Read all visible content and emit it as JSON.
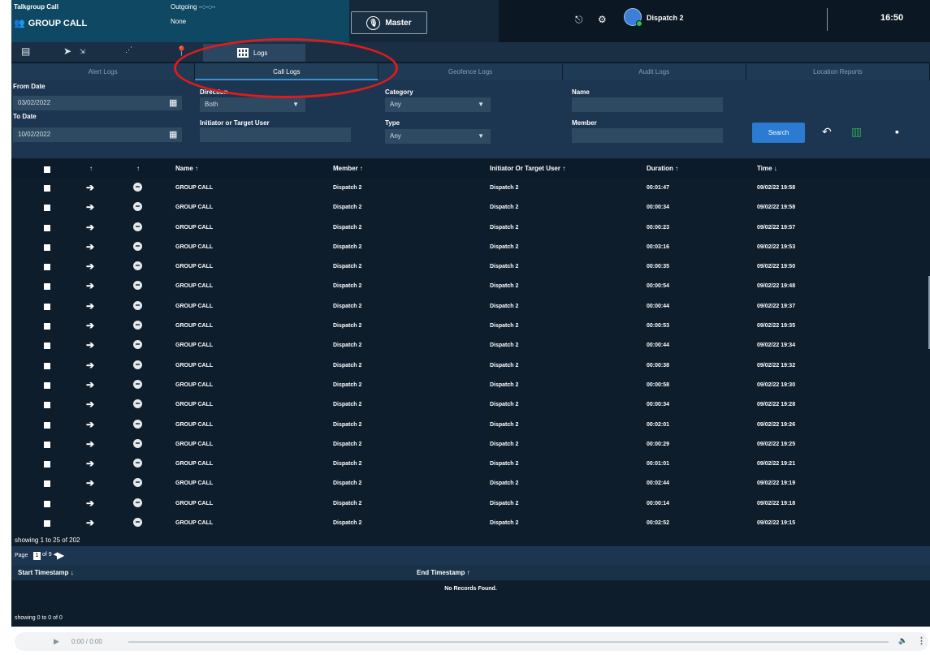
{
  "topbar": {
    "talkgroup_label": "Talkgroup Call",
    "group_name": "GROUP CALL",
    "outgoing_label": "Outgoing --:--:--",
    "outgoing_value": "None",
    "master_label": "Master",
    "user_name": "Dispatch 2",
    "clock": "16:50"
  },
  "nav": {
    "logs_label": "Logs"
  },
  "subtabs": [
    "Alert Logs",
    "Call Logs",
    "Geofence Logs",
    "Audit Logs",
    "Location Reports"
  ],
  "filters": {
    "from_date_label": "From Date",
    "from_date": "03/02/2022",
    "to_date_label": "To Date",
    "to_date": "10/02/2022",
    "direction_label": "Direction",
    "direction": "Both",
    "initiator_label": "Initiator or Target User",
    "initiator_value": "",
    "category_label": "Category",
    "category": "Any",
    "type_label": "Type",
    "type": "Any",
    "name_label": "Name",
    "name_value": "",
    "member_label": "Member",
    "member_value": "",
    "search_label": "Search"
  },
  "table": {
    "col_dir": "↑",
    "col_status": "↑",
    "headers": [
      "Name ↑",
      "Member ↑",
      "Initiator Or Target User ↑",
      "Duration ↑",
      "Time ↓"
    ],
    "rows": [
      {
        "name": "GROUP CALL",
        "member": "Dispatch 2",
        "initiator": "Dispatch 2",
        "duration": "00:01:47",
        "time": "09/02/22 19:58"
      },
      {
        "name": "GROUP CALL",
        "member": "Dispatch 2",
        "initiator": "Dispatch 2",
        "duration": "00:00:34",
        "time": "09/02/22 19:58"
      },
      {
        "name": "GROUP CALL",
        "member": "Dispatch 2",
        "initiator": "Dispatch 2",
        "duration": "00:00:23",
        "time": "09/02/22 19:57"
      },
      {
        "name": "GROUP CALL",
        "member": "Dispatch 2",
        "initiator": "Dispatch 2",
        "duration": "00:03:16",
        "time": "09/02/22 19:53"
      },
      {
        "name": "GROUP CALL",
        "member": "Dispatch 2",
        "initiator": "Dispatch 2",
        "duration": "00:00:35",
        "time": "09/02/22 19:50"
      },
      {
        "name": "GROUP CALL",
        "member": "Dispatch 2",
        "initiator": "Dispatch 2",
        "duration": "00:00:54",
        "time": "09/02/22 19:48"
      },
      {
        "name": "GROUP CALL",
        "member": "Dispatch 2",
        "initiator": "Dispatch 2",
        "duration": "00:00:44",
        "time": "09/02/22 19:37"
      },
      {
        "name": "GROUP CALL",
        "member": "Dispatch 2",
        "initiator": "Dispatch 2",
        "duration": "00:00:53",
        "time": "09/02/22 19:35"
      },
      {
        "name": "GROUP CALL",
        "member": "Dispatch 2",
        "initiator": "Dispatch 2",
        "duration": "00:00:44",
        "time": "09/02/22 19:34"
      },
      {
        "name": "GROUP CALL",
        "member": "Dispatch 2",
        "initiator": "Dispatch 2",
        "duration": "00:00:38",
        "time": "09/02/22 19:32"
      },
      {
        "name": "GROUP CALL",
        "member": "Dispatch 2",
        "initiator": "Dispatch 2",
        "duration": "00:00:58",
        "time": "09/02/22 19:30"
      },
      {
        "name": "GROUP CALL",
        "member": "Dispatch 2",
        "initiator": "Dispatch 2",
        "duration": "00:00:34",
        "time": "09/02/22 19:28"
      },
      {
        "name": "GROUP CALL",
        "member": "Dispatch 2",
        "initiator": "Dispatch 2",
        "duration": "00:02:01",
        "time": "09/02/22 19:26"
      },
      {
        "name": "GROUP CALL",
        "member": "Dispatch 2",
        "initiator": "Dispatch 2",
        "duration": "00:00:29",
        "time": "09/02/22 19:25"
      },
      {
        "name": "GROUP CALL",
        "member": "Dispatch 2",
        "initiator": "Dispatch 2",
        "duration": "00:01:01",
        "time": "09/02/22 19:21"
      },
      {
        "name": "GROUP CALL",
        "member": "Dispatch 2",
        "initiator": "Dispatch 2",
        "duration": "00:02:44",
        "time": "09/02/22 19:19"
      },
      {
        "name": "GROUP CALL",
        "member": "Dispatch 2",
        "initiator": "Dispatch 2",
        "duration": "00:00:14",
        "time": "09/02/22 19:18"
      },
      {
        "name": "GROUP CALL",
        "member": "Dispatch 2",
        "initiator": "Dispatch 2",
        "duration": "00:02:52",
        "time": "09/02/22 19:15"
      }
    ],
    "showing": "showing 1 to 25 of 202"
  },
  "pager": {
    "page_label": "Page",
    "page": "1",
    "of_label": "of 9 ◀"
  },
  "timestamps": {
    "start_header": "Start Timestamp ↓",
    "end_header": "End Timestamp ↑",
    "empty": "No Records Found.",
    "showing": "showing 0 to 0 of 0"
  },
  "audio": {
    "time": "0:00 / 0:00"
  },
  "colors": {
    "accent": "#2a7bd1",
    "annotation": "#e01b1b",
    "background": "#0d1d2c"
  }
}
